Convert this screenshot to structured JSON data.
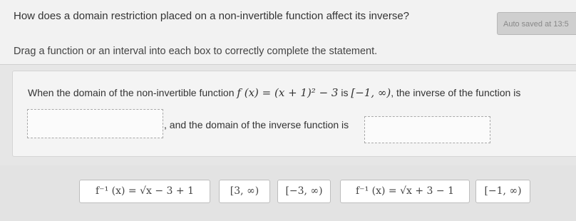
{
  "header": {
    "question": "How does a domain restriction placed on a non-invertible function affect its inverse?",
    "instructions": "Drag a function or an interval into each box to correctly complete the statement.",
    "autosave": "Auto saved at 13:5"
  },
  "statement": {
    "part1": "When the domain of the non-invertible function ",
    "function": "f (x) = (x + 1)² − 3",
    "part2": " is ",
    "domain": "[−1, ∞)",
    "part3": ", the inverse of the function is",
    "part4": ", and the domain of the inverse function is"
  },
  "tiles": [
    "f⁻¹ (x) = √x − 3 + 1",
    "[3, ∞)",
    "[−3, ∞)",
    "f⁻¹ (x) = √x + 3 − 1",
    "[−1, ∞)"
  ]
}
